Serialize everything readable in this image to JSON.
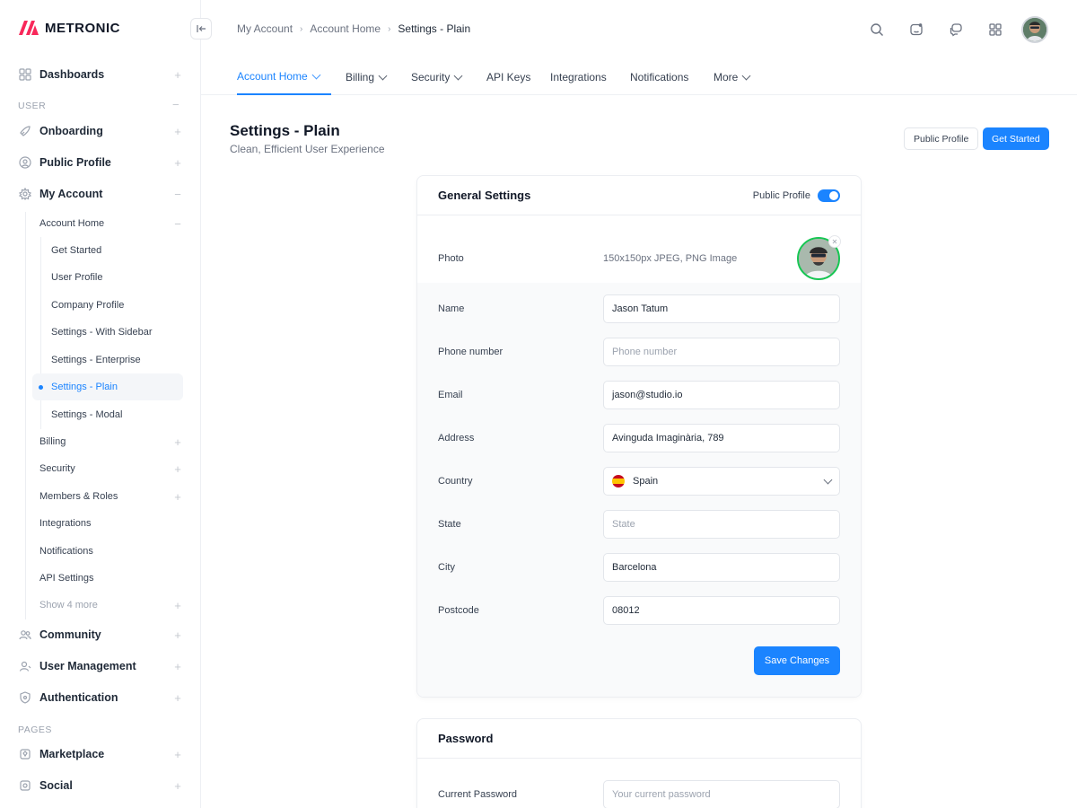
{
  "app": {
    "name": "METRONIC",
    "brand_color": "#f8285a",
    "accent": "#1b84ff"
  },
  "sidebar": {
    "top_items": [
      {
        "label": "Dashboards",
        "icon": "dashboard-icon"
      }
    ],
    "section_user": "USER",
    "user_items": [
      {
        "label": "Onboarding",
        "icon": "rocket-icon"
      },
      {
        "label": "Public Profile",
        "icon": "profile-circle-icon"
      },
      {
        "label": "My Account",
        "icon": "gear-icon"
      }
    ],
    "my_account_sub": [
      {
        "label": "Account Home"
      },
      {
        "label": "Billing"
      },
      {
        "label": "Security"
      },
      {
        "label": "Members & Roles"
      },
      {
        "label": "Integrations"
      },
      {
        "label": "Notifications"
      },
      {
        "label": "API Settings"
      },
      {
        "label": "Show 4 more"
      }
    ],
    "account_home_sub": [
      {
        "label": "Get Started"
      },
      {
        "label": "User Profile"
      },
      {
        "label": "Company Profile"
      },
      {
        "label": "Settings - With Sidebar"
      },
      {
        "label": "Settings - Enterprise"
      },
      {
        "label": "Settings - Plain",
        "active": true
      },
      {
        "label": "Settings - Modal"
      }
    ],
    "after_items": [
      {
        "label": "Community",
        "icon": "people-icon"
      },
      {
        "label": "User Management",
        "icon": "user-icon"
      },
      {
        "label": "Authentication",
        "icon": "shield-icon"
      }
    ],
    "section_pages": "PAGES",
    "page_items": [
      {
        "label": "Marketplace",
        "icon": "shop-icon"
      },
      {
        "label": "Social",
        "icon": "social-icon"
      }
    ]
  },
  "breadcrumb": [
    "My Account",
    "Account Home",
    "Settings - Plain"
  ],
  "header_icons": [
    "search-icon",
    "chat-face-icon",
    "messages-icon",
    "apps-grid-icon"
  ],
  "tabs": [
    {
      "label": "Account Home",
      "active": true,
      "dropdown": true
    },
    {
      "label": "Billing",
      "dropdown": true
    },
    {
      "label": "Security",
      "dropdown": true
    },
    {
      "label": "API Keys"
    },
    {
      "label": "Integrations"
    },
    {
      "label": "Notifications"
    },
    {
      "label": "More",
      "dropdown": true
    }
  ],
  "page": {
    "title": "Settings - Plain",
    "subtitle": "Clean, Efficient User Experience",
    "btn_public_profile": "Public Profile",
    "btn_get_started": "Get Started"
  },
  "general": {
    "title": "General Settings",
    "toggle_label": "Public Profile",
    "toggle_on": true,
    "photo_label": "Photo",
    "photo_hint": "150x150px JPEG, PNG Image",
    "fields": [
      {
        "label": "Name",
        "value": "Jason Tatum",
        "placeholder": ""
      },
      {
        "label": "Phone number",
        "value": "",
        "placeholder": "Phone number"
      },
      {
        "label": "Email",
        "value": "jason@studio.io",
        "placeholder": ""
      },
      {
        "label": "Address",
        "value": "Avinguda Imaginària, 789",
        "placeholder": ""
      },
      {
        "label": "Country",
        "value": "Spain",
        "placeholder": ""
      },
      {
        "label": "State",
        "value": "",
        "placeholder": "State"
      },
      {
        "label": "City",
        "value": "Barcelona",
        "placeholder": ""
      },
      {
        "label": "Postcode",
        "value": "08012",
        "placeholder": ""
      }
    ],
    "save_label": "Save Changes"
  },
  "password": {
    "title": "Password",
    "current_label": "Current Password",
    "current_placeholder": "Your current password"
  }
}
